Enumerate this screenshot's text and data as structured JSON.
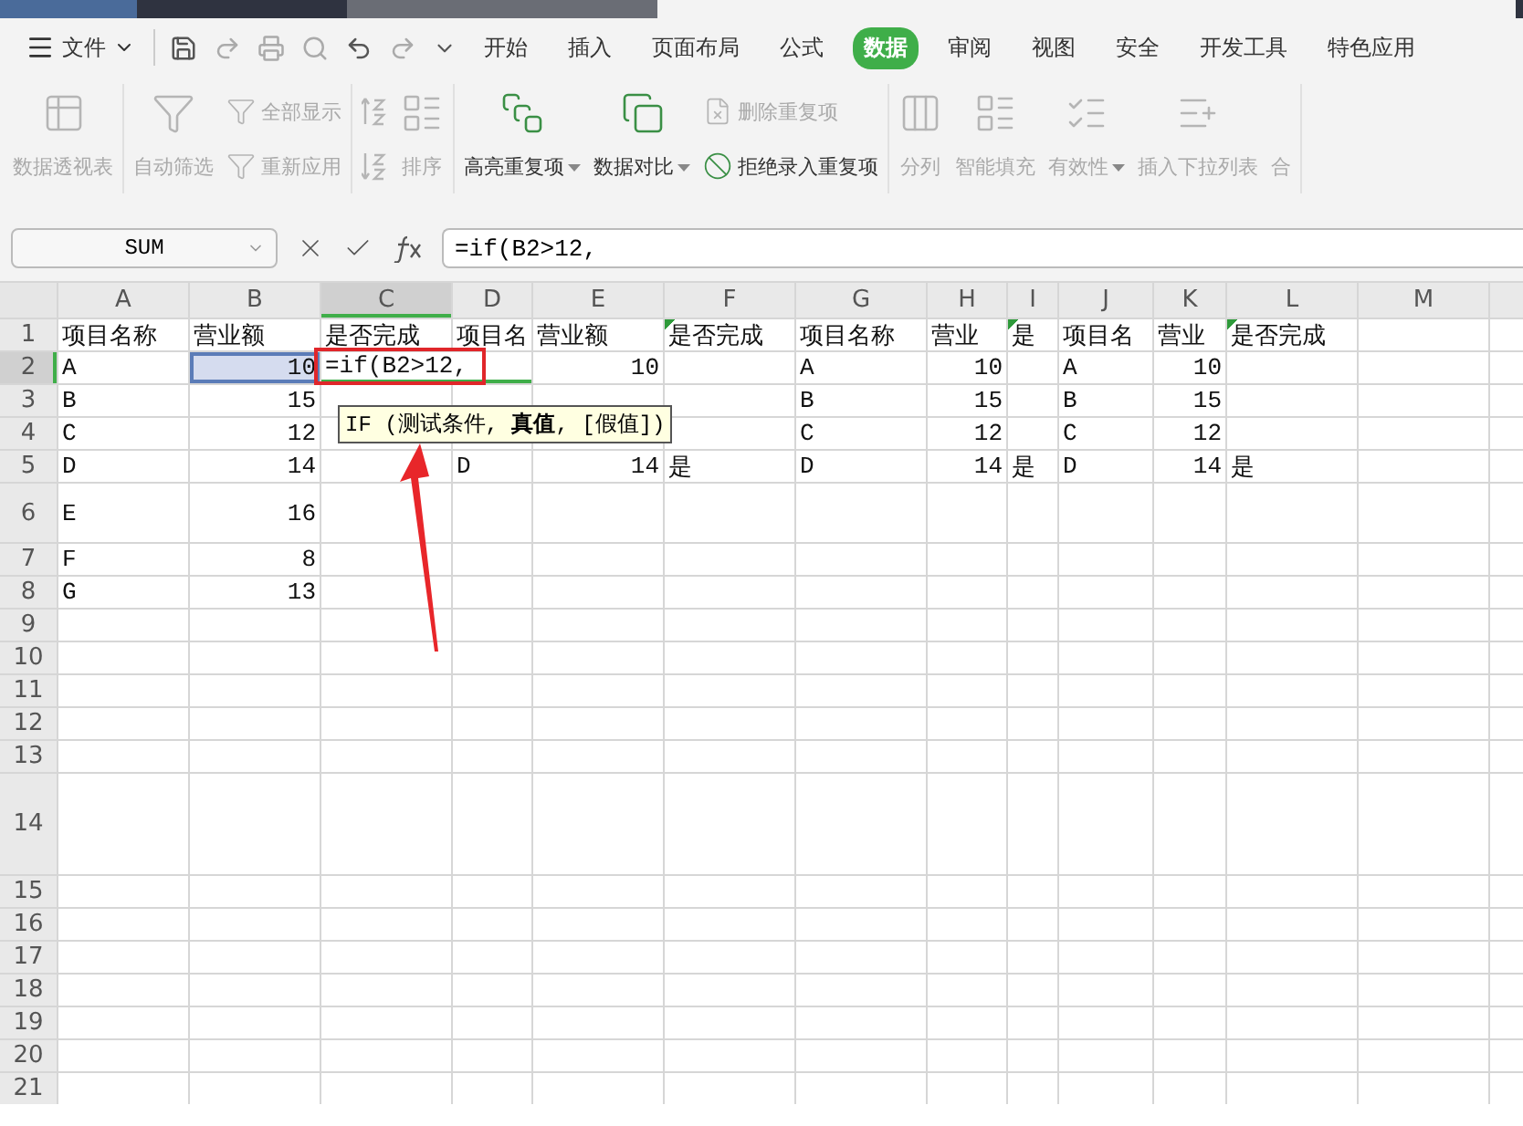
{
  "menu": {
    "file": "文件",
    "tabs": [
      {
        "label": "开始",
        "selected": false
      },
      {
        "label": "插入",
        "selected": false
      },
      {
        "label": "页面布局",
        "selected": false
      },
      {
        "label": "公式",
        "selected": false
      },
      {
        "label": "数据",
        "selected": true
      },
      {
        "label": "审阅",
        "selected": false
      },
      {
        "label": "视图",
        "selected": false
      },
      {
        "label": "安全",
        "selected": false
      },
      {
        "label": "开发工具",
        "selected": false
      },
      {
        "label": "特色应用",
        "selected": false
      }
    ]
  },
  "ribbon": [
    {
      "items": [
        {
          "kind": "large",
          "label": "数据透视表",
          "disabled": true,
          "dropdown": false
        }
      ]
    },
    {
      "items": [
        {
          "kind": "large",
          "label": "自动筛选",
          "disabled": true,
          "dropdown": false
        },
        {
          "kind": "stack",
          "items": [
            {
              "label": "全部显示",
              "disabled": true
            },
            {
              "label": "重新应用",
              "disabled": true
            }
          ]
        }
      ]
    },
    {
      "items": [
        {
          "kind": "sort-icons"
        },
        {
          "kind": "large",
          "label": "排序",
          "disabled": true,
          "dropdown": false
        }
      ]
    },
    {
      "items": [
        {
          "kind": "large",
          "label": "高亮重复项",
          "disabled": false,
          "dropdown": true
        },
        {
          "kind": "large",
          "label": "数据对比",
          "disabled": false,
          "dropdown": true
        },
        {
          "kind": "stack",
          "items": [
            {
              "label": "删除重复项",
              "disabled": true
            },
            {
              "label": "拒绝录入重复项",
              "disabled": false
            }
          ]
        }
      ]
    },
    {
      "items": [
        {
          "kind": "large",
          "label": "分列",
          "disabled": true,
          "dropdown": false
        },
        {
          "kind": "large",
          "label": "智能填充",
          "disabled": true,
          "dropdown": false
        },
        {
          "kind": "large",
          "label": "有效性",
          "disabled": true,
          "dropdown": true
        },
        {
          "kind": "large",
          "label": "插入下拉列表",
          "disabled": true,
          "dropdown": false
        },
        {
          "kind": "large",
          "label": "合",
          "disabled": true,
          "dropdown": false
        }
      ]
    }
  ],
  "formula_bar": {
    "name_box": "SUM",
    "formula": "=if(B2>12,"
  },
  "columns": [
    {
      "label": "A",
      "selected": false
    },
    {
      "label": "B",
      "selected": false
    },
    {
      "label": "C",
      "selected": true
    },
    {
      "label": "D",
      "selected": false
    },
    {
      "label": "E",
      "selected": false
    },
    {
      "label": "F",
      "selected": false
    },
    {
      "label": "G",
      "selected": false
    },
    {
      "label": "H",
      "selected": false
    },
    {
      "label": "I",
      "selected": false
    },
    {
      "label": "J",
      "selected": false
    },
    {
      "label": "K",
      "selected": false
    },
    {
      "label": "L",
      "selected": false
    },
    {
      "label": "M",
      "selected": false
    }
  ],
  "rows": [
    {
      "label": "1",
      "selected": false,
      "kind": "normal",
      "cells": [
        {
          "text": "项目名称"
        },
        {
          "text": "营业额"
        },
        {
          "text": "是否完成"
        },
        {
          "text": "项目名"
        },
        {
          "text": "营业额"
        },
        {
          "text": "是否完成",
          "flag": true
        },
        {
          "text": "项目名称"
        },
        {
          "text": "营业"
        },
        {
          "text": "是",
          "flag": true
        },
        {
          "text": "项目名"
        },
        {
          "text": "营业"
        },
        {
          "text": "是否完成",
          "flag": true
        },
        null
      ]
    },
    {
      "label": "2",
      "selected": true,
      "kind": "normal",
      "cells": [
        {
          "text": "A"
        },
        {
          "text": "10",
          "kind": "number",
          "selected": true
        },
        {
          "text": "=if(B2>12,",
          "kind": "editing"
        },
        null,
        {
          "text": "10",
          "kind": "number"
        },
        null,
        {
          "text": "A"
        },
        {
          "text": "10",
          "kind": "number"
        },
        null,
        {
          "text": "A"
        },
        {
          "text": "10",
          "kind": "number"
        },
        null,
        null
      ]
    },
    {
      "label": "3",
      "selected": false,
      "kind": "normal",
      "cells": [
        {
          "text": "B"
        },
        {
          "text": "15",
          "kind": "number"
        },
        null,
        null,
        null,
        null,
        {
          "text": "B"
        },
        {
          "text": "15",
          "kind": "number"
        },
        null,
        {
          "text": "B"
        },
        {
          "text": "15",
          "kind": "number"
        },
        null,
        null
      ]
    },
    {
      "label": "4",
      "selected": false,
      "kind": "normal",
      "cells": [
        {
          "text": "C"
        },
        {
          "text": "12",
          "kind": "number"
        },
        null,
        null,
        null,
        null,
        {
          "text": "C"
        },
        {
          "text": "12",
          "kind": "number"
        },
        null,
        {
          "text": "C"
        },
        {
          "text": "12",
          "kind": "number"
        },
        null,
        null
      ]
    },
    {
      "label": "5",
      "selected": false,
      "kind": "normal",
      "cells": [
        {
          "text": "D"
        },
        {
          "text": "14",
          "kind": "number"
        },
        null,
        {
          "text": "D"
        },
        {
          "text": "14",
          "kind": "number"
        },
        {
          "text": "是"
        },
        {
          "text": "D"
        },
        {
          "text": "14",
          "kind": "number"
        },
        {
          "text": "是"
        },
        {
          "text": "D"
        },
        {
          "text": "14",
          "kind": "number"
        },
        {
          "text": "是"
        },
        null
      ]
    },
    {
      "label": "6",
      "selected": false,
      "kind": "tall",
      "cells": [
        {
          "text": "E"
        },
        {
          "text": "16",
          "kind": "number"
        },
        null,
        null,
        null,
        null,
        null,
        null,
        null,
        null,
        null,
        null,
        null
      ]
    },
    {
      "label": "7",
      "selected": false,
      "kind": "normal",
      "cells": [
        {
          "text": "F"
        },
        {
          "text": "8",
          "kind": "number"
        },
        null,
        null,
        null,
        null,
        null,
        null,
        null,
        null,
        null,
        null,
        null
      ]
    },
    {
      "label": "8",
      "selected": false,
      "kind": "normal",
      "cells": [
        {
          "text": "G"
        },
        {
          "text": "13",
          "kind": "number"
        },
        null,
        null,
        null,
        null,
        null,
        null,
        null,
        null,
        null,
        null,
        null
      ]
    },
    {
      "label": "9",
      "selected": false,
      "kind": "normal",
      "cells": []
    },
    {
      "label": "10",
      "selected": false,
      "kind": "normal",
      "cells": []
    },
    {
      "label": "11",
      "selected": false,
      "kind": "normal",
      "cells": []
    },
    {
      "label": "12",
      "selected": false,
      "kind": "normal",
      "cells": []
    },
    {
      "label": "13",
      "selected": false,
      "kind": "normal",
      "cells": []
    },
    {
      "label": "14",
      "selected": false,
      "kind": "huge",
      "cells": []
    },
    {
      "label": "15",
      "selected": false,
      "kind": "normal",
      "cells": []
    },
    {
      "label": "16",
      "selected": false,
      "kind": "normal",
      "cells": []
    },
    {
      "label": "17",
      "selected": false,
      "kind": "normal",
      "cells": []
    },
    {
      "label": "18",
      "selected": false,
      "kind": "normal",
      "cells": []
    },
    {
      "label": "19",
      "selected": false,
      "kind": "normal",
      "cells": []
    },
    {
      "label": "20",
      "selected": false,
      "kind": "normal",
      "cells": []
    },
    {
      "label": "21",
      "selected": false,
      "kind": "normal",
      "cells": []
    }
  ],
  "tooltip": {
    "text": "IF (测试条件, **真值**, [假值])"
  }
}
